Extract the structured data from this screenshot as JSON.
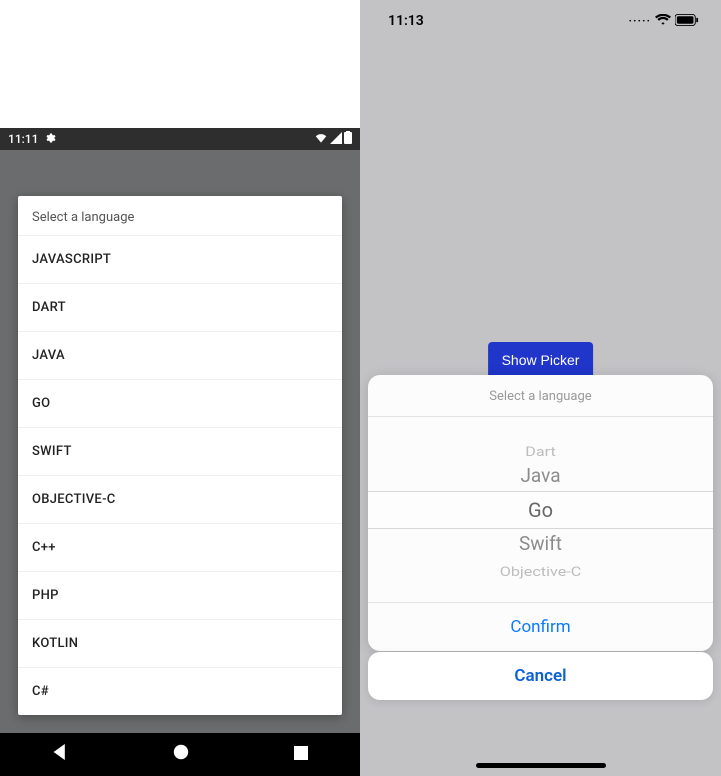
{
  "android": {
    "status": {
      "time": "11:11",
      "gear": "⚙",
      "wifi": "▾",
      "cell": "◣",
      "batt": "▮"
    },
    "dialog": {
      "title": "Select a language",
      "items": [
        "JAVASCRIPT",
        "DART",
        "JAVA",
        "GO",
        "SWIFT",
        "OBJECTIVE-C",
        "C++",
        "PHP",
        "KOTLIN",
        "C#"
      ]
    },
    "nav": {
      "back": "◀",
      "home": "⬤",
      "recent": "■"
    }
  },
  "ios": {
    "status": {
      "time": "11:13",
      "dots": "·····",
      "wifi": "ᯤ",
      "batt": "▮▮"
    },
    "show_picker": "Show Picker",
    "picker": {
      "title": "Select a language",
      "rows": [
        "",
        "Dart",
        "Java",
        "Go",
        "Swift",
        "Objective-C",
        ""
      ],
      "confirm": "Confirm"
    },
    "cancel": "Cancel"
  }
}
